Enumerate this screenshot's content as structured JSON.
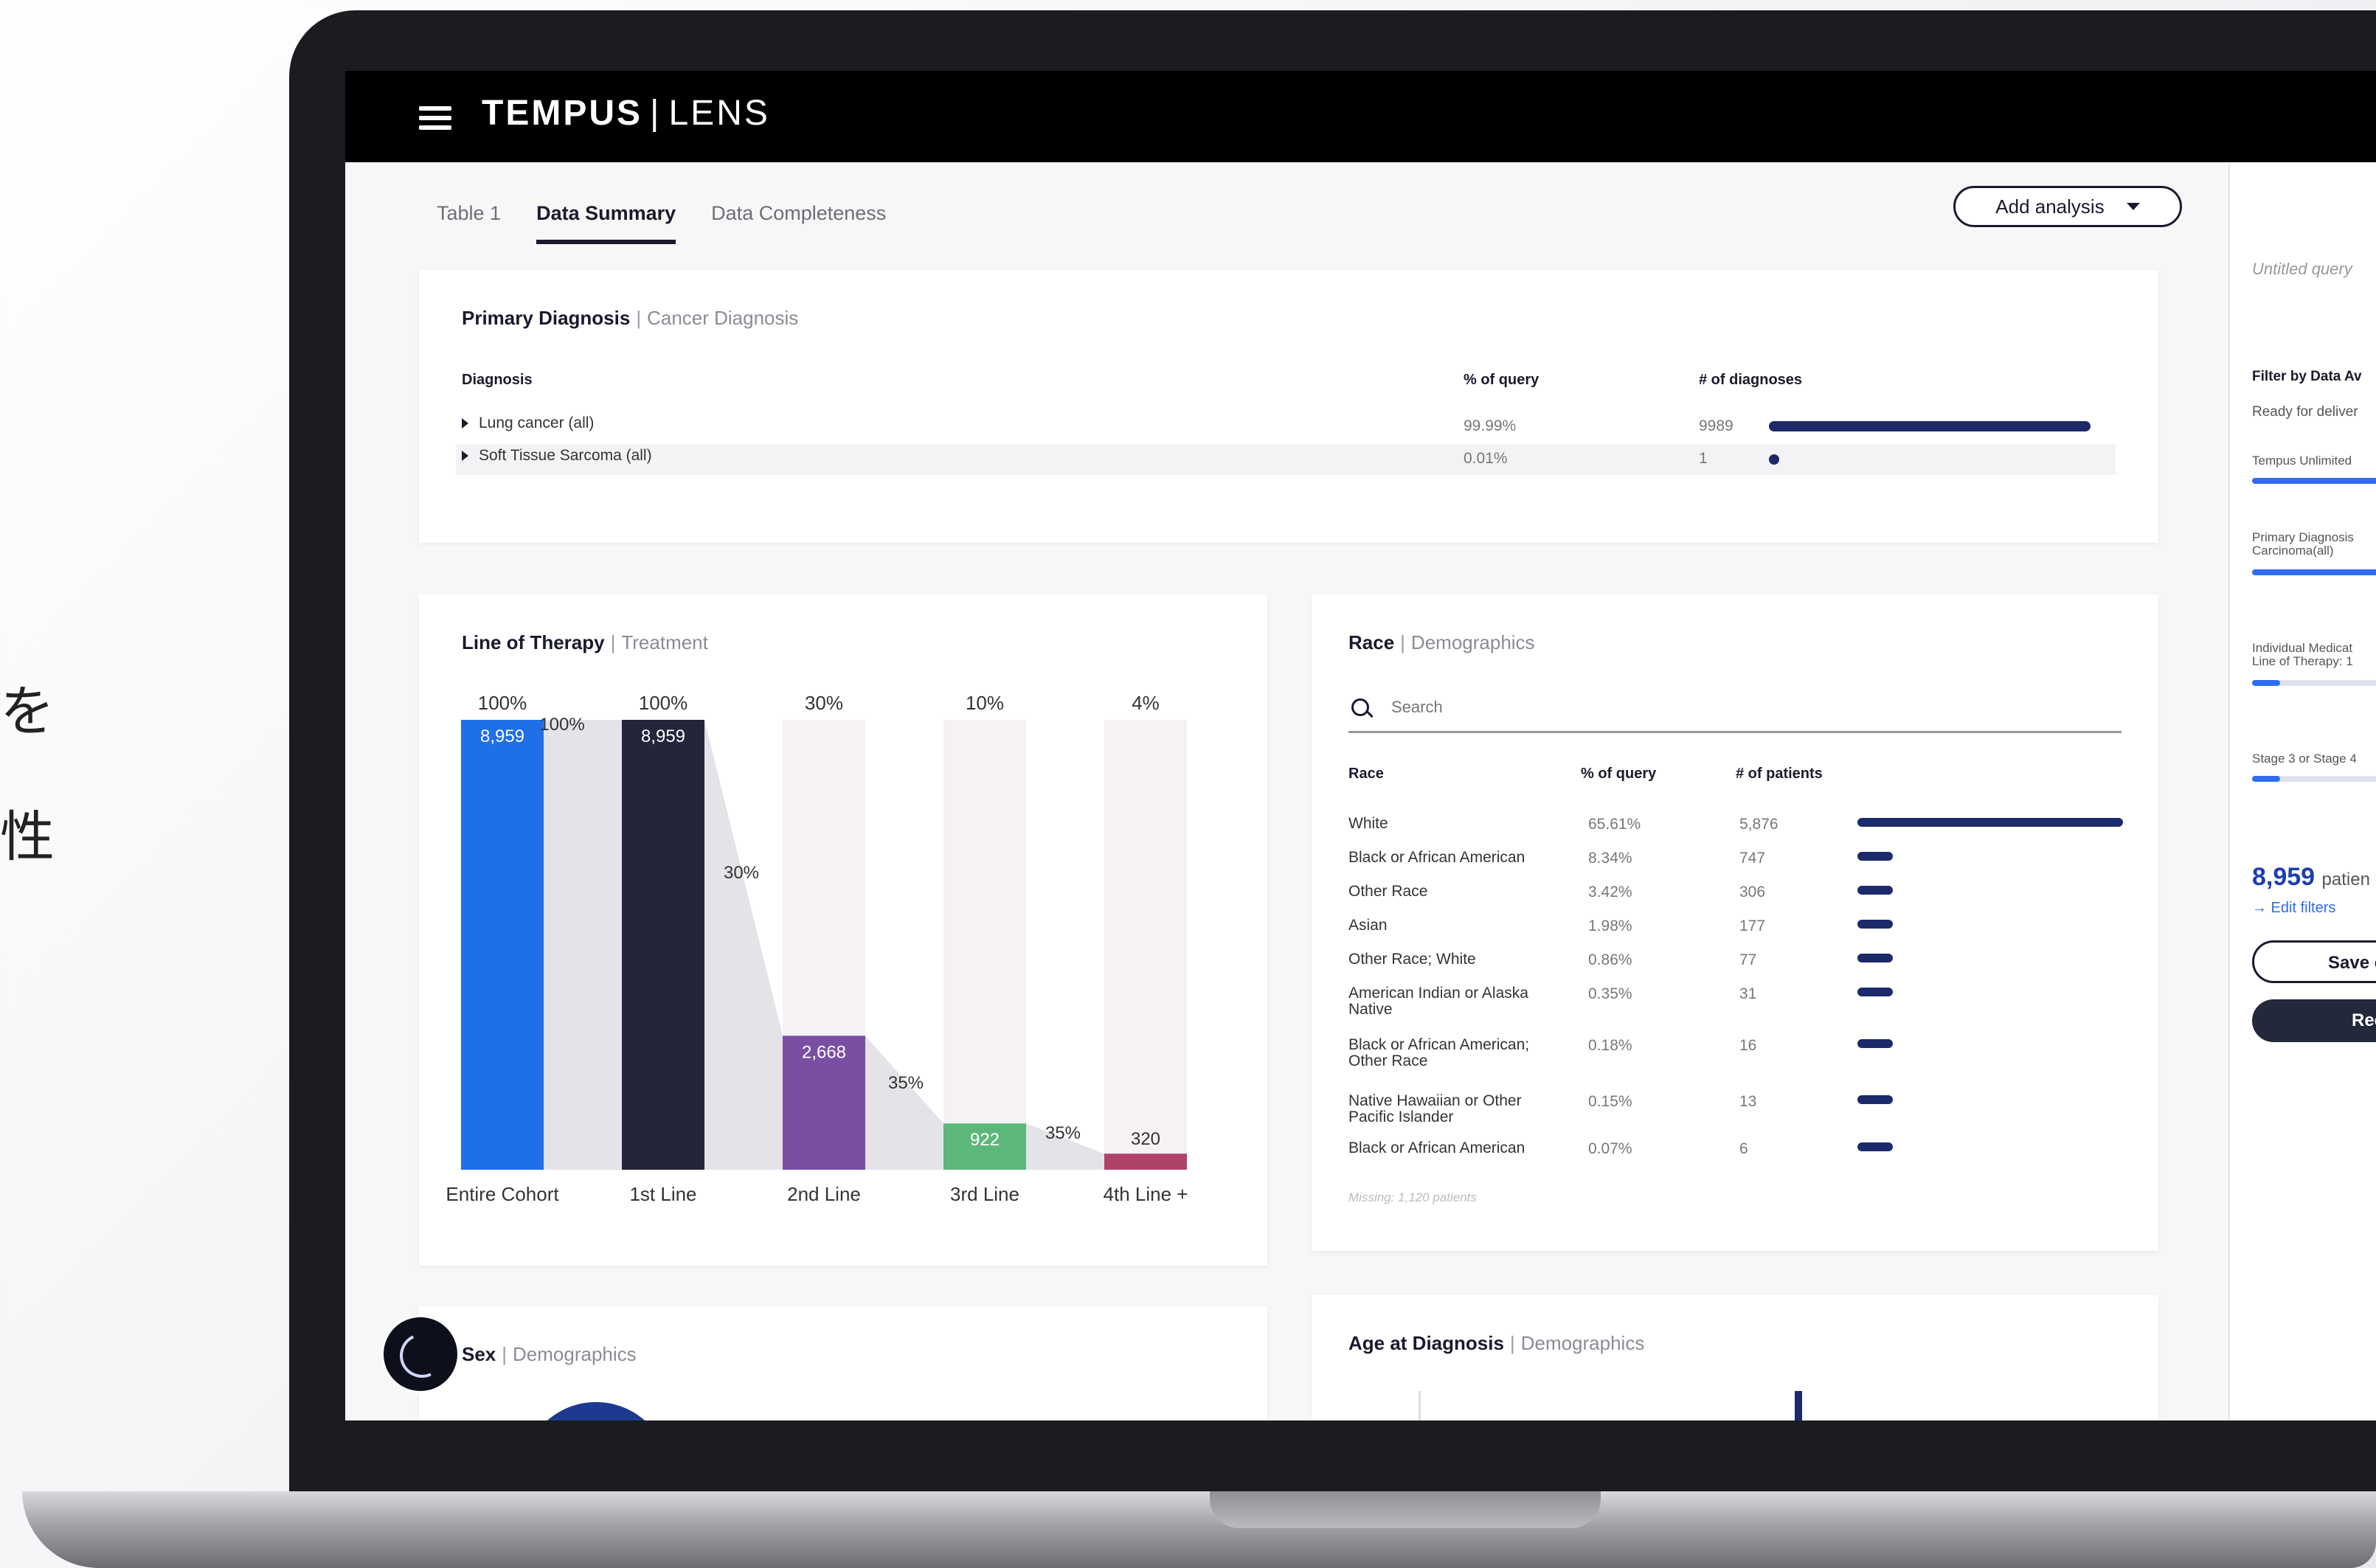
{
  "side_text": [
    "を",
    "性"
  ],
  "app": {
    "brand_bold": "TEMPUS",
    "brand_light": "LENS"
  },
  "tabs": [
    "Table 1",
    "Data Summary",
    "Data Completeness"
  ],
  "active_tab": "Data Summary",
  "add_analysis_label": "Add analysis",
  "primary_diagnosis": {
    "title": "Primary Diagnosis",
    "subtitle": "Cancer Diagnosis",
    "headers": {
      "diagnosis": "Diagnosis",
      "pct": "% of query",
      "count": "# of diagnoses"
    },
    "rows": [
      {
        "name": "Lung cancer (all)",
        "pct": "99.99%",
        "count": "9989",
        "share": 0.9999
      },
      {
        "name": "Soft Tissue Sarcoma (all)",
        "pct": "0.01%",
        "count": "1",
        "share": 0.0001
      }
    ]
  },
  "line_of_therapy": {
    "title": "Line of Therapy",
    "subtitle": "Treatment"
  },
  "chart_data": {
    "type": "bar",
    "categories": [
      "Entire Cohort",
      "1st Line",
      "2nd Line",
      "3rd Line",
      "4th Line +"
    ],
    "values": [
      8959,
      8959,
      2668,
      922,
      320
    ],
    "value_labels": [
      "8,959",
      "8,959",
      "2,668",
      "922",
      "320"
    ],
    "percent_labels": [
      "100%",
      "100%",
      "30%",
      "10%",
      "4%"
    ],
    "transition_labels": [
      "100%",
      "30%",
      "35%",
      "35%"
    ],
    "colors": [
      "#1f6fe8",
      "#23253a",
      "#7a4fa3",
      "#5cb87a",
      "#b0426a"
    ],
    "ylim": [
      0,
      8959
    ]
  },
  "race": {
    "title": "Race",
    "subtitle": "Demographics",
    "search_placeholder": "Search",
    "headers": {
      "race": "Race",
      "pct": "% of query",
      "count": "# of patients"
    },
    "rows": [
      {
        "name": "White",
        "pct": "65.61%",
        "count": "5,876",
        "share": 0.6561
      },
      {
        "name": "Black or African American",
        "pct": "8.34%",
        "count": "747",
        "share": 0.0834
      },
      {
        "name": "Other Race",
        "pct": "3.42%",
        "count": "306",
        "share": 0.0342
      },
      {
        "name": "Asian",
        "pct": "1.98%",
        "count": "177",
        "share": 0.0198
      },
      {
        "name": "Other Race; White",
        "pct": "0.86%",
        "count": "77",
        "share": 0.0086
      },
      {
        "name": "American Indian or Alaska Native",
        "pct": "0.35%",
        "count": "31",
        "share": 0.0035
      },
      {
        "name": "Black or African American; Other Race",
        "pct": "0.18%",
        "count": "16",
        "share": 0.0018
      },
      {
        "name": "Native Hawaiian or Other Pacific Islander",
        "pct": "0.15%",
        "count": "13",
        "share": 0.0015
      },
      {
        "name": "Black or African American",
        "pct": "0.07%",
        "count": "6",
        "share": 0.0007
      }
    ],
    "missing_note": "Missing: 1,120 patients"
  },
  "sex": {
    "title": "Sex",
    "subtitle": "Demographics"
  },
  "age": {
    "title": "Age at Diagnosis",
    "subtitle": "Demographics"
  },
  "right_panel": {
    "query_name": "Untitled query",
    "filter_heading": "Filter by Data Av",
    "ready_text": "Ready for deliver",
    "filters": [
      {
        "label": "Tempus Unlimited",
        "level": 1.0
      },
      {
        "label": "Primary Diagnosis Carcinoma(all)",
        "level": 0.95
      },
      {
        "label": "Individual Medicat Line of Therapy: 1",
        "level": 0.2
      },
      {
        "label": "Stage 3 or Stage 4",
        "level": 0.2
      }
    ],
    "patient_count": "8,959",
    "patient_word": "patien",
    "edit_filters": "→ Edit filters",
    "save_label": "Save c",
    "request_label": "Rec"
  }
}
